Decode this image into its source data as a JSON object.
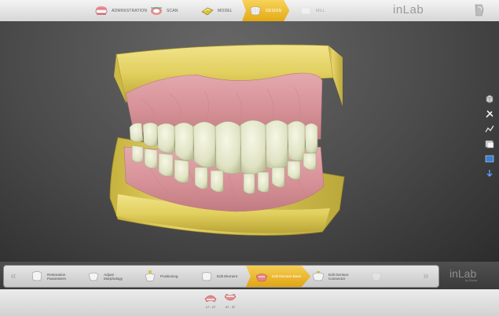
{
  "header": {
    "phases": [
      {
        "label": "ADMINISTRATION",
        "icon": "administration-icon",
        "state": "normal"
      },
      {
        "label": "SCAN",
        "icon": "scan-icon",
        "state": "normal"
      },
      {
        "label": "MODEL",
        "icon": "model-icon",
        "state": "normal"
      },
      {
        "label": "DESIGN",
        "icon": "design-icon",
        "state": "active"
      },
      {
        "label": "MILL",
        "icon": "mill-icon",
        "state": "disabled"
      }
    ],
    "logo": "inLab",
    "save_icon": "save-icon"
  },
  "right_toolbar": [
    "view-cube-icon",
    "tools-icon",
    "analysis-icon",
    "objects-icon",
    "screenshot-icon",
    "download-icon"
  ],
  "steps": {
    "prev_icon": "double-chevron-left-icon",
    "next_icon": "double-chevron-right-icon",
    "items": [
      {
        "label": "Restoration\nParameters",
        "icon": "restoration-parameters-icon",
        "state": "normal"
      },
      {
        "label": "Adjust\nMorphology",
        "icon": "adjust-morphology-icon",
        "state": "normal"
      },
      {
        "label": "Positioning",
        "icon": "positioning-icon",
        "state": "normal"
      },
      {
        "label": "Edit Element",
        "icon": "edit-element-icon",
        "state": "normal"
      },
      {
        "label": "Edit Denture Base",
        "icon": "edit-denture-base-icon",
        "state": "active"
      },
      {
        "label": "Edit Denture\nConnector",
        "icon": "edit-denture-connector-icon",
        "state": "normal"
      },
      {
        "label": "",
        "icon": "next-step-icon",
        "state": "disabled"
      }
    ],
    "brand": "inLab",
    "brand_sub": "by Sirona"
  },
  "jaws": [
    {
      "label": "17 - 27",
      "icon": "upper-jaw-icon"
    },
    {
      "label": "47 - 37",
      "icon": "lower-jaw-icon"
    }
  ],
  "colors": {
    "accent": "#e8ae1e",
    "model_yellow": "#e6d56c",
    "gum_pink": "#d8959a",
    "tooth": "#e9ecd2",
    "viewport_bg": "#4a4a4a"
  }
}
